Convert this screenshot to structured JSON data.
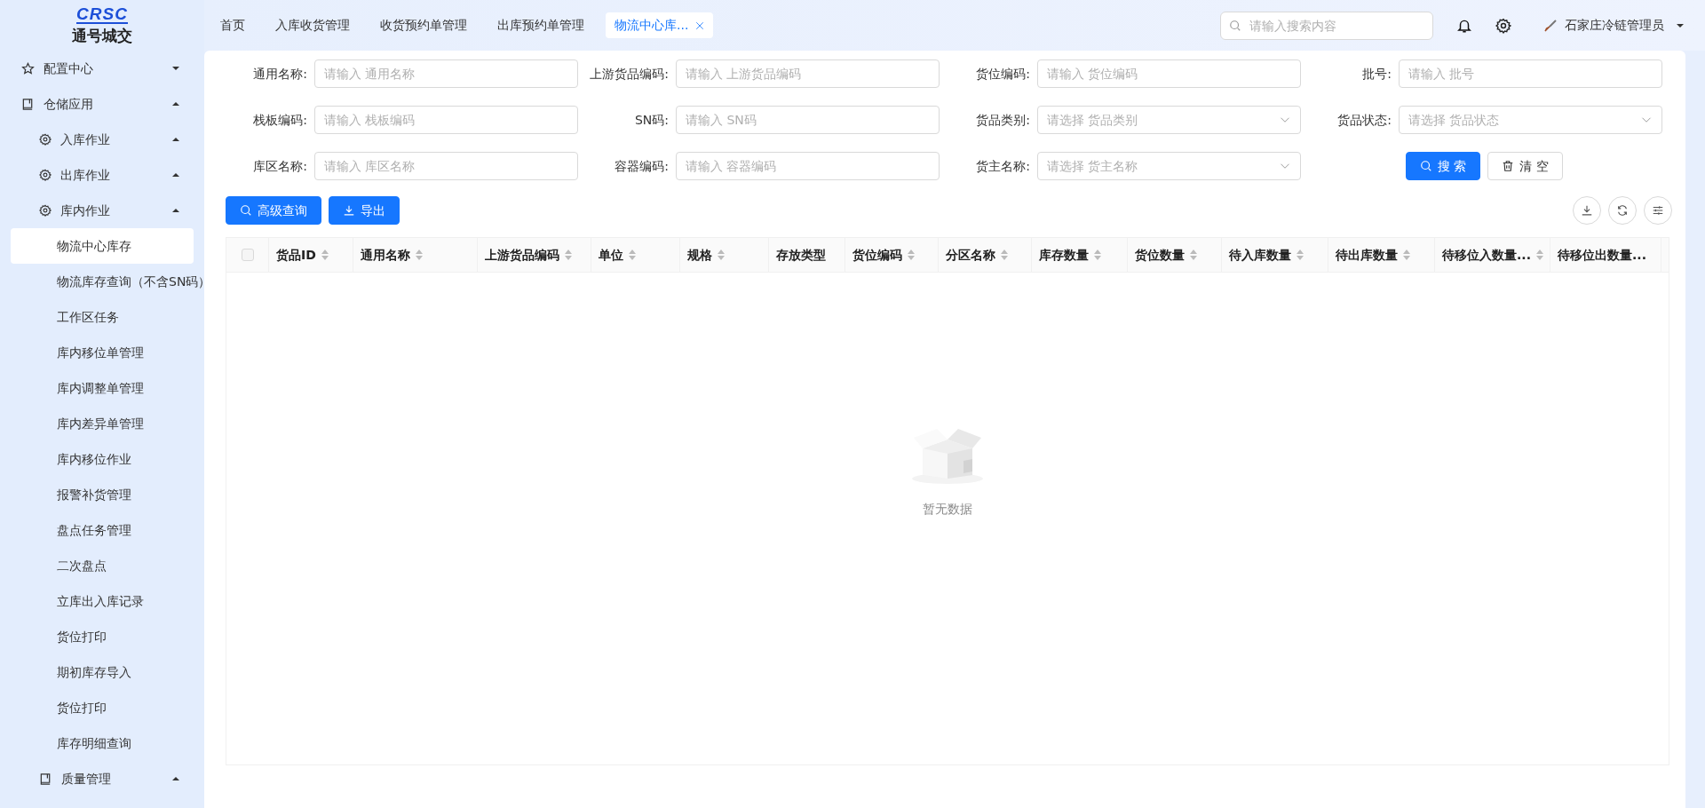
{
  "logo": {
    "mark": "CRSC",
    "name": "通号城交"
  },
  "sidebar": {
    "items": [
      {
        "label": "配置中心",
        "kind": "favorites",
        "expanded": false
      },
      {
        "label": "仓储应用",
        "kind": "module",
        "expanded": true,
        "children": [
          {
            "label": "入库作业",
            "kind": "group",
            "expanded": true
          },
          {
            "label": "出库作业",
            "kind": "group",
            "expanded": true
          },
          {
            "label": "库内作业",
            "kind": "group",
            "expanded": true,
            "children": [
              {
                "label": "物流中心库存",
                "selected": true
              },
              {
                "label": "物流库存查询（不含SN码）",
                "selected": false
              },
              {
                "label": "工作区任务",
                "selected": false
              },
              {
                "label": "库内移位单管理",
                "selected": false
              },
              {
                "label": "库内调整单管理",
                "selected": false
              },
              {
                "label": "库内差异单管理",
                "selected": false
              },
              {
                "label": "库内移位作业",
                "selected": false
              },
              {
                "label": "报警补货管理",
                "selected": false
              },
              {
                "label": "盘点任务管理",
                "selected": false
              },
              {
                "label": "二次盘点",
                "selected": false
              },
              {
                "label": "立库出入库记录",
                "selected": false
              },
              {
                "label": "货位打印",
                "selected": false
              },
              {
                "label": "期初库存导入",
                "selected": false
              },
              {
                "label": "货位打印",
                "selected": false
              },
              {
                "label": "库存明细查询",
                "selected": false
              }
            ]
          },
          {
            "label": "质量管理",
            "kind": "module",
            "expanded": true
          }
        ]
      }
    ]
  },
  "tabs": [
    {
      "label": "首页",
      "selected": false
    },
    {
      "label": "入库收货管理",
      "selected": false
    },
    {
      "label": "收货预约单管理",
      "selected": false
    },
    {
      "label": "出库预约单管理",
      "selected": false
    },
    {
      "label": "物流中心库...",
      "selected": true
    }
  ],
  "header": {
    "search": {
      "placeholder": "请输入搜索内容"
    },
    "user": "石家庄冷链管理员"
  },
  "filters": [
    {
      "label": "通用名称:",
      "kind": "input",
      "placeholder": "请输入 通用名称"
    },
    {
      "label": "上游货品编码:",
      "kind": "input",
      "placeholder": "请输入 上游货品编码"
    },
    {
      "label": "货位编码:",
      "kind": "input",
      "placeholder": "请输入 货位编码"
    },
    {
      "label": "批号:",
      "kind": "input",
      "placeholder": "请输入 批号"
    },
    {
      "label": "栈板编码:",
      "kind": "input",
      "placeholder": "请输入 栈板编码"
    },
    {
      "label": "SN码:",
      "kind": "input",
      "placeholder": "请输入 SN码"
    },
    {
      "label": "货品类别:",
      "kind": "select",
      "placeholder": "请选择 货品类别"
    },
    {
      "label": "货品状态:",
      "kind": "select",
      "placeholder": "请选择 货品状态"
    },
    {
      "label": "库区名称:",
      "kind": "input",
      "placeholder": "请输入 库区名称"
    },
    {
      "label": "容器编码:",
      "kind": "input",
      "placeholder": "请输入 容器编码"
    },
    {
      "label": "货主名称:",
      "kind": "select",
      "placeholder": "请选择 货主名称"
    }
  ],
  "filter_buttons": [
    {
      "label": "搜 索",
      "kind": "search"
    },
    {
      "label": "清 空",
      "kind": "clear"
    }
  ],
  "toolbar": [
    {
      "label": "高级查询",
      "kind": "search"
    },
    {
      "label": "导出",
      "kind": "export"
    }
  ],
  "table": {
    "select_all": {
      "checked": false
    },
    "columns": [
      {
        "label": "货品ID",
        "sortable": true
      },
      {
        "label": "通用名称",
        "sortable": true
      },
      {
        "label": "上游货品编码",
        "sortable": true
      },
      {
        "label": "单位",
        "sortable": true
      },
      {
        "label": "规格",
        "sortable": true
      },
      {
        "label": "存放类型",
        "sortable": false
      },
      {
        "label": "货位编码",
        "sortable": true
      },
      {
        "label": "分区名称",
        "sortable": true
      },
      {
        "label": "库存数量",
        "sortable": true
      },
      {
        "label": "货位数量",
        "sortable": true
      },
      {
        "label": "待入库数量",
        "sortable": true
      },
      {
        "label": "待出库数量",
        "sortable": true
      },
      {
        "label": "待移位入数量...",
        "sortable": true
      },
      {
        "label": "待移位出数量...",
        "sortable": false
      }
    ],
    "empty_text": "暂无数据"
  }
}
